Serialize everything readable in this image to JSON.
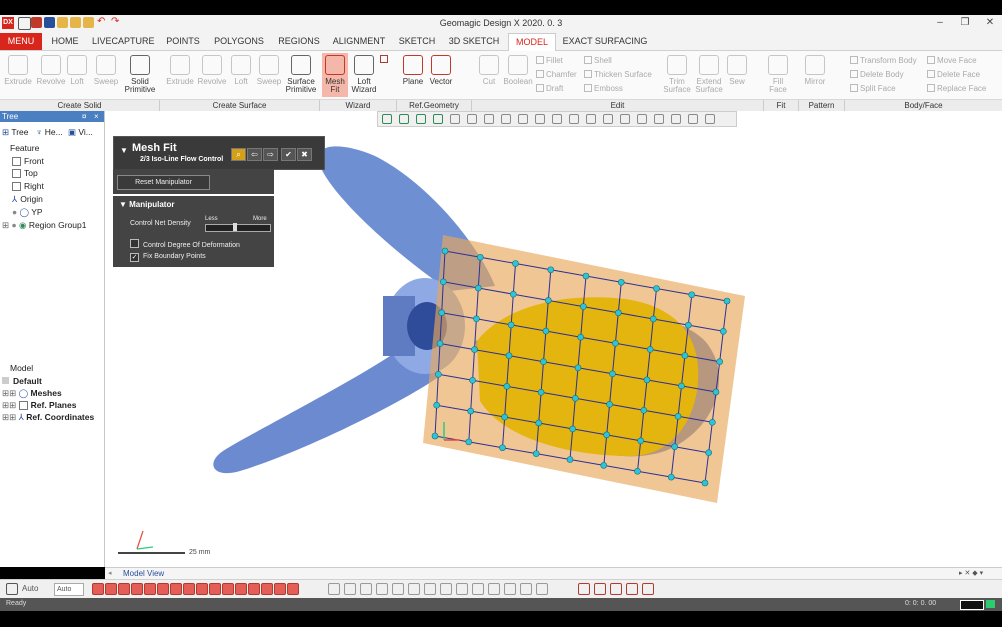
{
  "app": {
    "title": "Geomagic Design X 2020. 0. 3",
    "logo": "DX"
  },
  "window_controls": {
    "minimize": "–",
    "maximize": "❐",
    "close": "✕"
  },
  "menu_tabs": [
    "MENU",
    "HOME",
    "LIVECAPTURE",
    "POINTS",
    "POLYGONS",
    "REGIONS",
    "ALIGNMENT",
    "SKETCH",
    "3D SKETCH",
    "MODEL",
    "EXACT SURFACING"
  ],
  "ribbon": {
    "create_solid": [
      "Extrude",
      "Revolve",
      "Loft",
      "Sweep",
      "Solid Primitive"
    ],
    "create_surface": [
      "Extrude",
      "Revolve",
      "Loft",
      "Sweep",
      "Surface Primitive"
    ],
    "wizard": [
      "Mesh Fit",
      "Loft Wizard"
    ],
    "ref_geometry": [
      "Plane",
      "Vector"
    ],
    "edit_large": [
      "Cut",
      "Boolean"
    ],
    "edit_small": [
      "Fillet",
      "Chamfer",
      "Draft",
      "Shell",
      "Thicken Surface",
      "Emboss"
    ],
    "edit_right": [
      "Trim Surface",
      "Extend Surface",
      "Sew"
    ],
    "fit": [
      "Fill Face"
    ],
    "pattern": [
      "Mirror"
    ],
    "body_face": [
      "Transform Body",
      "Delete Body",
      "Split Face",
      "Move Face",
      "Delete Face",
      "Replace Face"
    ],
    "groups": [
      "Create Solid",
      "Create Surface",
      "Wizard",
      "Ref.Geometry",
      "Edit",
      "Fit",
      "Pattern",
      "Body/Face"
    ]
  },
  "tree_panel": {
    "header": "Tree",
    "tabs": [
      "Tree",
      "He...",
      "Vi..."
    ],
    "feature_label": "Feature",
    "features": [
      "Front",
      "Top",
      "Right",
      "Origin",
      "YP",
      "Region Group1"
    ],
    "model_label": "Model",
    "model_default": "Default",
    "model_items": [
      "Meshes",
      "Ref. Planes",
      "Ref. Coordinates"
    ]
  },
  "mesh_fit": {
    "title": "Mesh Fit",
    "step": "2/3 Iso-Line Flow Control",
    "reset_button": "Reset Manipulator",
    "manipulator_title": "Manipulator",
    "density_label": "Control Net Density",
    "less": "Less",
    "more": "More",
    "density_value": 0.45,
    "options": [
      {
        "label": "Control Degree Of Deformation",
        "checked": false
      },
      {
        "label": "Fix Boundary Points",
        "checked": true
      }
    ]
  },
  "viewport": {
    "scale_text": "25 mm",
    "model_view_tab": "Model View",
    "axis_x": "X",
    "axis_y": "Y"
  },
  "bottom_toolbar": {
    "auto_label": "Auto",
    "auto_select": "Auto"
  },
  "status_bar": {
    "left": "Ready",
    "right": "0: 0: 0. 00"
  },
  "colors": {
    "accent": "#d9261c",
    "ribbon_active": "#f4b7a9",
    "propeller": "#6f8fd3",
    "patch": "#e8a85a",
    "mesh": "#e3b50e",
    "grid": "#2c2f9a",
    "node": "#2ec3d6"
  }
}
